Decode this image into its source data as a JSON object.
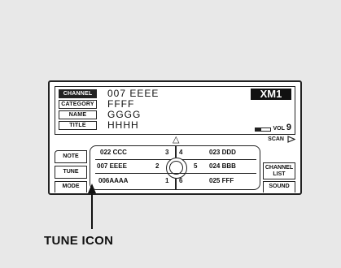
{
  "display": {
    "fields": [
      {
        "label": "CHANNEL",
        "value": "007 EEEE"
      },
      {
        "label": "CATEGORY",
        "value": "FFFF"
      },
      {
        "label": "NAME",
        "value": "GGGG"
      },
      {
        "label": "TITLE",
        "value": "HHHH"
      }
    ],
    "band": "XM1",
    "volume_label": "VOL",
    "volume_value": "9",
    "scan_label": "SCAN"
  },
  "buttons": {
    "note": "NOTE",
    "tune": "TUNE",
    "mode": "MODE",
    "channel_list_line1": "CHANNEL",
    "channel_list_line2": "LIST",
    "sound": "SOUND"
  },
  "presets": {
    "left": [
      {
        "name": "022 CCC",
        "num": "3"
      },
      {
        "name": "007 EEEE",
        "num": "2"
      },
      {
        "name": "006AAAA",
        "num": "1"
      }
    ],
    "right": [
      {
        "name": "023 DDD",
        "num": "4"
      },
      {
        "name": "024 BBB",
        "num": "5"
      },
      {
        "name": "025 FFF",
        "num": "6"
      }
    ]
  },
  "callout": {
    "label": "TUNE ICON"
  }
}
